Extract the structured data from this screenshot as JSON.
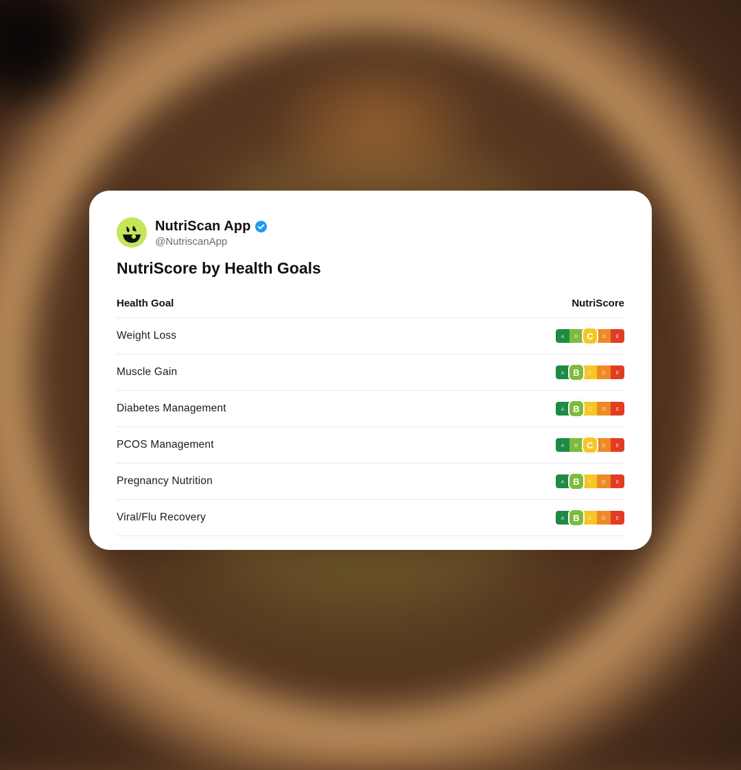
{
  "post": {
    "account_name": "NutriScan App",
    "handle": "@NutriscanApp",
    "title": "NutriScore by Health Goals"
  },
  "table": {
    "headers": {
      "goal": "Health Goal",
      "score": "NutriScore"
    },
    "grades": [
      "A",
      "B",
      "C",
      "D",
      "E"
    ],
    "grade_colors": {
      "A": "#1e8a45",
      "B": "#7dbb3c",
      "C": "#f6c626",
      "D": "#ee8a25",
      "E": "#e23c25"
    },
    "rows": [
      {
        "goal": "Weight Loss",
        "score": "C"
      },
      {
        "goal": "Muscle Gain",
        "score": "B"
      },
      {
        "goal": "Diabetes Management",
        "score": "B"
      },
      {
        "goal": "PCOS Management",
        "score": "C"
      },
      {
        "goal": "Pregnancy Nutrition",
        "score": "B"
      },
      {
        "goal": "Viral/Flu Recovery",
        "score": "B"
      }
    ]
  },
  "icons": {
    "avatar": "nutriscan-logo-icon",
    "verified": "verified-badge-icon"
  },
  "colors": {
    "avatar_bg": "#c4e65a",
    "verified_blue": "#1d9bf0"
  }
}
